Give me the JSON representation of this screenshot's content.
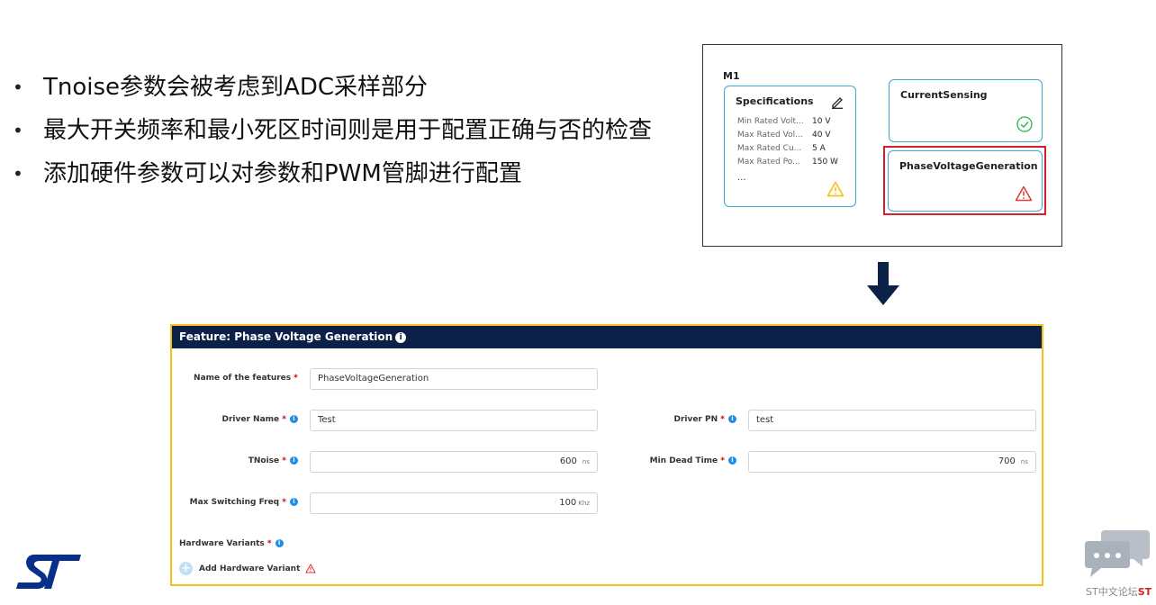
{
  "bullets": [
    "Tnoise参数会被考虑到ADC采样部分",
    "最大开关频率和最小死区时间则是用于配置正确与否的检查",
    "添加硬件参数可以对参数和PWM管脚进行配置"
  ],
  "m1": {
    "title": "M1",
    "specifications": {
      "title": "Specifications",
      "rows": [
        {
          "name": "Min Rated Volt...",
          "value": "10 V"
        },
        {
          "name": "Max Rated Vol...",
          "value": "40 V"
        },
        {
          "name": "Max Rated Cu...",
          "value": "5 A"
        },
        {
          "name": "Max Rated Po...",
          "value": "150 W"
        }
      ],
      "more": "..."
    },
    "current_sensing": {
      "title": "CurrentSensing"
    },
    "phase_voltage": {
      "title": "PhaseVoltageGeneration"
    }
  },
  "feature": {
    "header": "Feature: Phase Voltage Generation",
    "info_glyph": "i",
    "name_label": "Name of the features",
    "name_value": "PhaseVoltageGeneration",
    "driver_name_label": "Driver Name",
    "driver_name_value": "Test",
    "driver_pn_label": "Driver PN",
    "driver_pn_value": "test",
    "tnoise_label": "TNoise",
    "tnoise_value": "600",
    "tnoise_unit": "ns",
    "min_dead_label": "Min Dead Time",
    "min_dead_value": "700",
    "min_dead_unit": "ns",
    "max_freq_label": "Max Switching Freq",
    "max_freq_value": "100",
    "max_freq_unit": "Khz",
    "hw_label": "Hardware Variants",
    "add_hw_label": "Add Hardware Variant",
    "required_mark": "*"
  },
  "forum": {
    "text": "ST中文论坛",
    "st": "ST"
  },
  "colors": {
    "header_bg": "#0c2147",
    "feature_border": "#f3c21b",
    "card_border": "#3aa9d6",
    "highlight_red": "#d61f26",
    "check_green": "#2db34a",
    "warn_yellow": "#f2c200",
    "warn_red": "#e03a3a",
    "info_blue": "#1e8de6",
    "st_logo_blue": "#0a2f8a"
  },
  "icons": [
    "edit-icon",
    "warning-icon",
    "check-circle-icon",
    "info-icon",
    "plus-circle-icon",
    "down-arrow-icon",
    "st-logo",
    "chat-bubble-icon"
  ]
}
